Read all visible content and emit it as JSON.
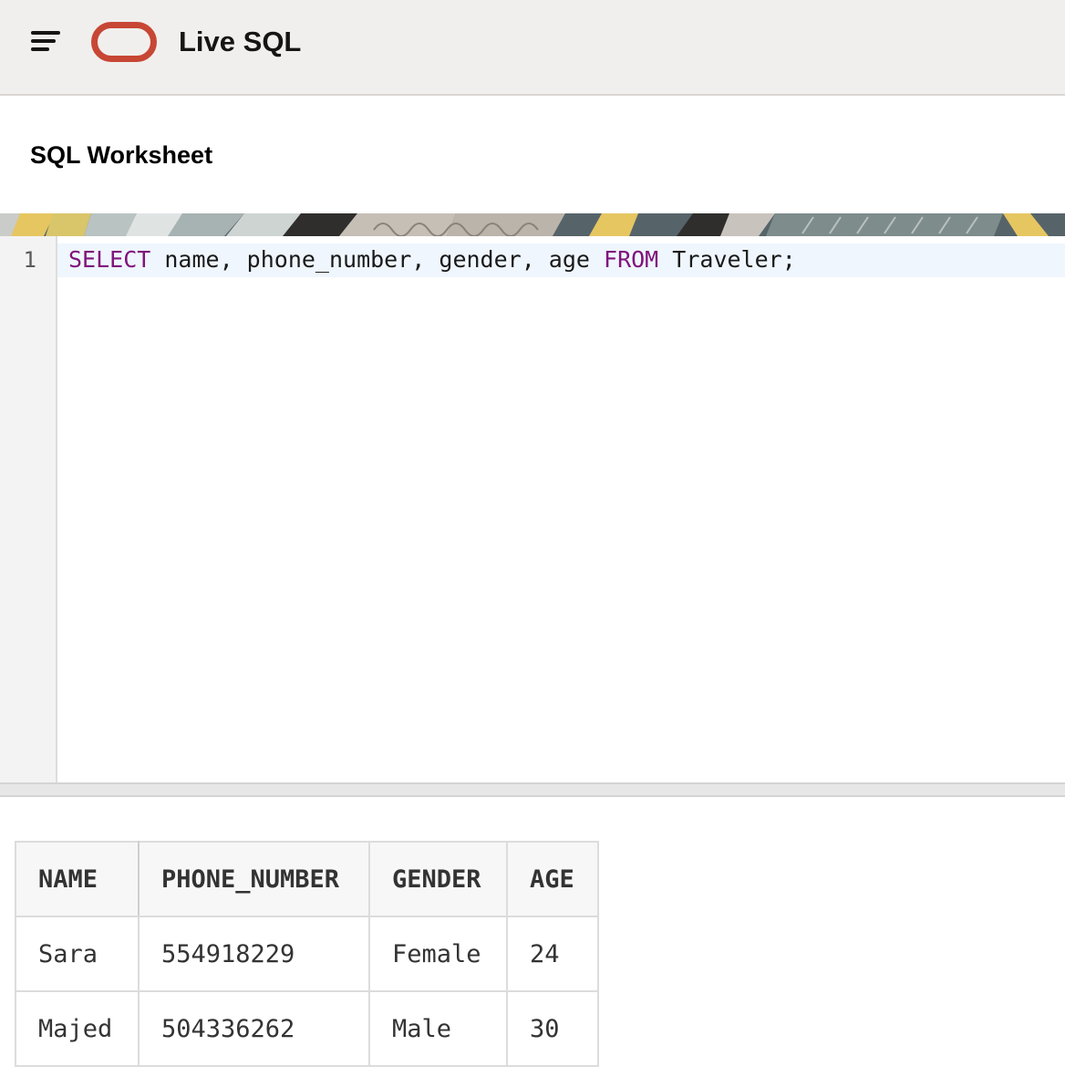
{
  "header": {
    "title": "Live SQL",
    "logo_color": "#c74634",
    "menu_icon": "hamburger-menu-icon",
    "logo_icon": "oracle-logo-icon"
  },
  "page": {
    "title": "SQL Worksheet"
  },
  "editor": {
    "lines": [
      {
        "number": "1",
        "tokens": [
          {
            "text": "SELECT",
            "type": "keyword"
          },
          {
            "text": " name, phone_number, gender, age ",
            "type": "plain"
          },
          {
            "text": "FROM",
            "type": "keyword"
          },
          {
            "text": " Traveler;",
            "type": "plain"
          }
        ]
      }
    ],
    "keyword_color": "#80137a"
  },
  "results": {
    "columns": [
      "NAME",
      "PHONE_NUMBER",
      "GENDER",
      "AGE"
    ],
    "rows": [
      [
        "Sara",
        "554918229",
        "Female",
        "24"
      ],
      [
        "Majed",
        "504336262",
        "Male",
        "30"
      ]
    ]
  }
}
